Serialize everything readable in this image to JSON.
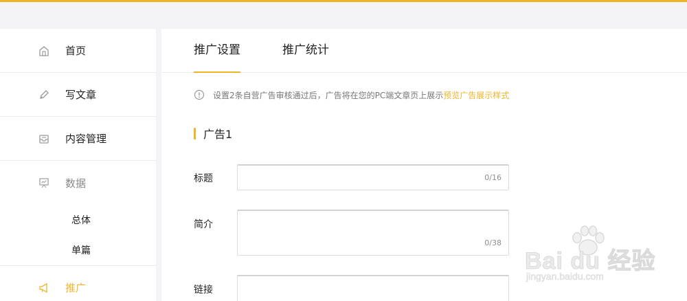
{
  "sidebar": {
    "items": [
      {
        "label": "首页",
        "icon": "home-icon"
      },
      {
        "label": "写文章",
        "icon": "pencil-icon"
      },
      {
        "label": "内容管理",
        "icon": "inbox-icon"
      },
      {
        "label": "数据",
        "icon": "presentation-chart-icon",
        "sub": [
          "总体",
          "单篇"
        ]
      },
      {
        "label": "推广",
        "icon": "megaphone-icon"
      }
    ]
  },
  "tabs": [
    {
      "label": "推广设置",
      "active": true
    },
    {
      "label": "推广统计",
      "active": false
    }
  ],
  "notice": {
    "text": "设置2条自营广告审核通过后，广告将在您的PC端文章页上展示",
    "link": "预览广告展示样式"
  },
  "section": {
    "title": "广告1"
  },
  "form": {
    "title_label": "标题",
    "title_counter": "0/16",
    "intro_label": "简介",
    "intro_counter": "0/38",
    "link_label": "链接"
  },
  "watermark": {
    "logo": "Bai du 经验",
    "url": "jingyan.baidu.com"
  },
  "colors": {
    "accent": "#f0b429",
    "background": "#f4f4f6"
  }
}
